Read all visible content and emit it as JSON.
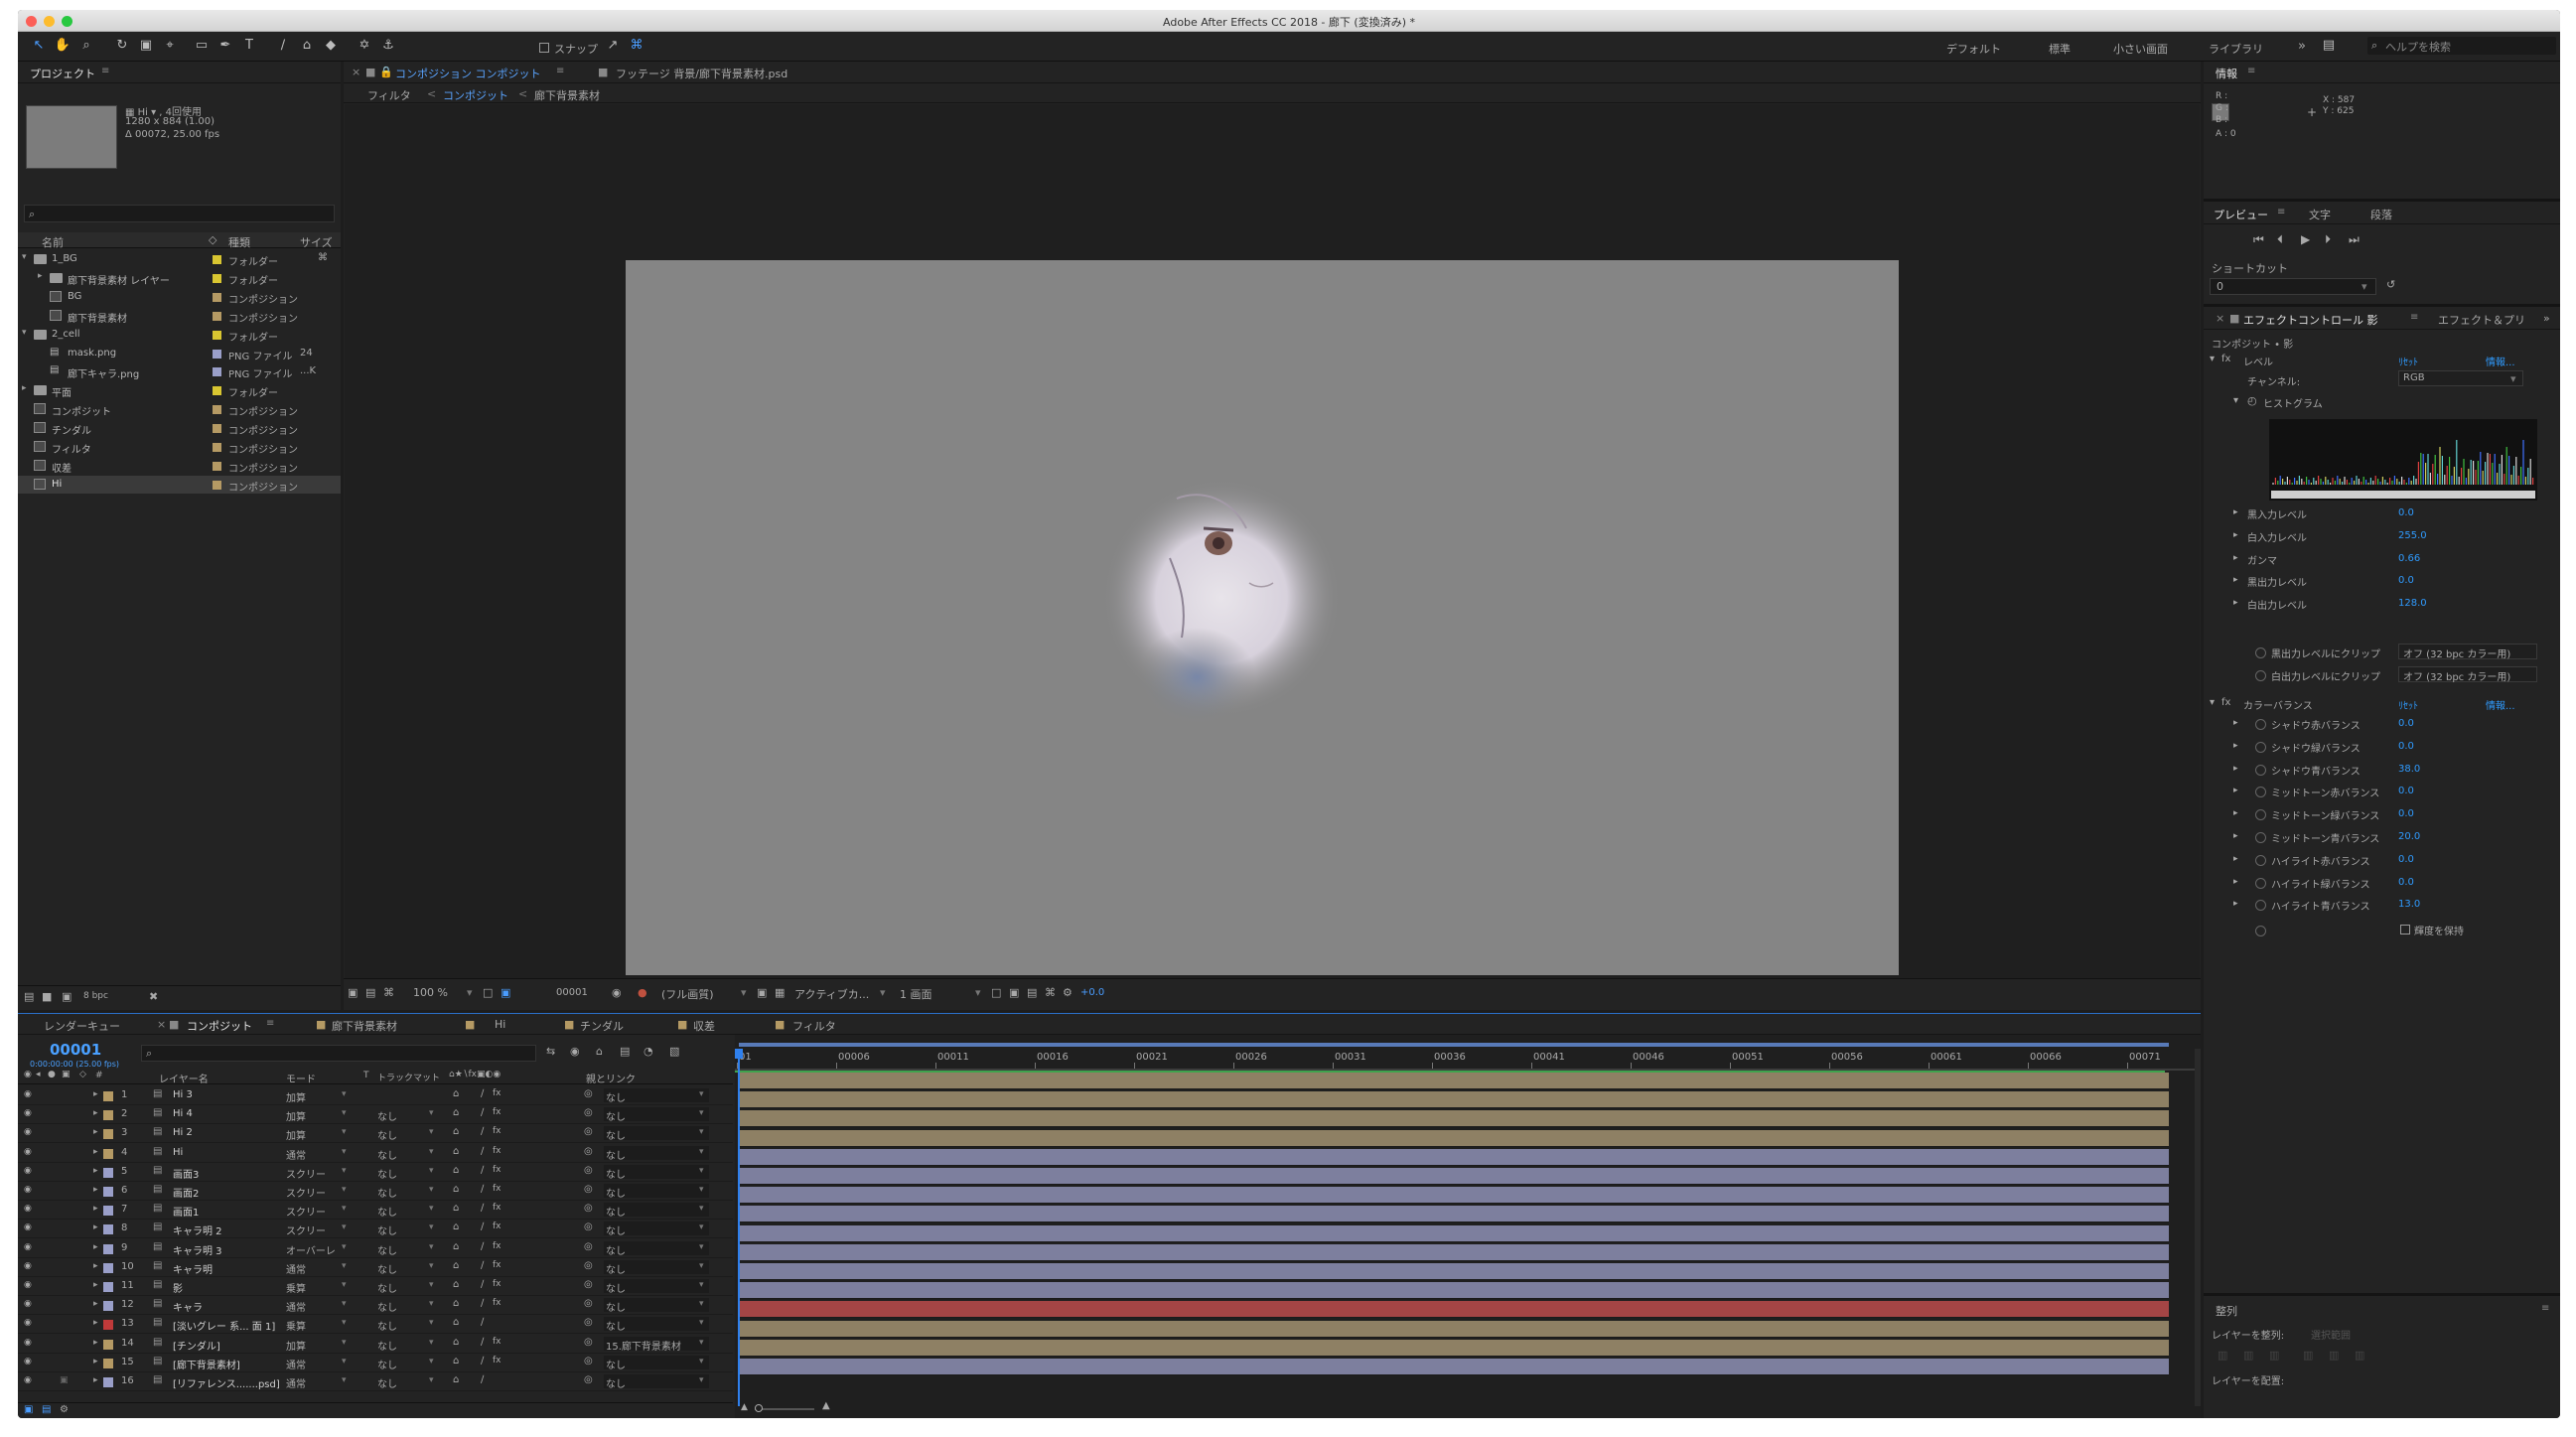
{
  "app": {
    "title": "Adobe After Effects CC 2018 - 廊下 (変換済み) *"
  },
  "toolbar": {
    "snap_label": "スナップ",
    "workspaces": [
      "デフォルト",
      "標準",
      "小さい画面",
      "ライブラリ"
    ],
    "more": "»",
    "search_placeholder": "ヘルプを検索"
  },
  "project": {
    "title": "プロジェクト",
    "thumb_info": [
      "▦ Hi ▾ , 4回使用",
      "1280 x 884 (1.00)",
      "Δ 00072, 25.00 fps"
    ],
    "search_placeholder": "",
    "columns": {
      "name": "名前",
      "type": "種類",
      "size": "サイズ"
    },
    "items": [
      {
        "name": "1_BG",
        "type": "フォルダー",
        "size": "",
        "kind": "folder",
        "indent": 0,
        "open": true,
        "color": "#d9c631"
      },
      {
        "name": "廊下背景素材 レイヤー",
        "type": "フォルダー",
        "size": "",
        "kind": "folder",
        "indent": 1,
        "open": false,
        "color": "#d9c631"
      },
      {
        "name": "BG",
        "type": "コンポジション",
        "size": "",
        "kind": "comp",
        "indent": 1,
        "color": "#b59a64"
      },
      {
        "name": "廊下背景素材",
        "type": "コンポジション",
        "size": "",
        "kind": "comp",
        "indent": 1,
        "color": "#b59a64"
      },
      {
        "name": "2_cell",
        "type": "フォルダー",
        "size": "",
        "kind": "folder",
        "indent": 0,
        "open": true,
        "color": "#d9c631"
      },
      {
        "name": "mask.png",
        "type": "PNG ファイル",
        "size": "24",
        "kind": "file",
        "indent": 1,
        "color": "#9a9fc9"
      },
      {
        "name": "廊下キャラ.png",
        "type": "PNG ファイル",
        "size": "...K",
        "kind": "file",
        "indent": 1,
        "color": "#9a9fc9"
      },
      {
        "name": "平面",
        "type": "フォルダー",
        "size": "",
        "kind": "folder",
        "indent": 0,
        "open": false,
        "color": "#d9c631"
      },
      {
        "name": "コンポジット",
        "type": "コンポジション",
        "size": "",
        "kind": "comp",
        "indent": 0,
        "color": "#b59a64"
      },
      {
        "name": "チンダル",
        "type": "コンポジション",
        "size": "",
        "kind": "comp",
        "indent": 0,
        "color": "#b59a64"
      },
      {
        "name": "フィルタ",
        "type": "コンポジション",
        "size": "",
        "kind": "comp",
        "indent": 0,
        "color": "#b59a64"
      },
      {
        "name": "収差",
        "type": "コンポジション",
        "size": "",
        "kind": "comp",
        "indent": 0,
        "color": "#b59a64"
      },
      {
        "name": "Hi",
        "type": "コンポジション",
        "size": "",
        "kind": "comp",
        "indent": 0,
        "color": "#b59a64",
        "selected": true
      }
    ],
    "bpc": "8 bpc"
  },
  "viewer": {
    "tabs": [
      "コンポジション コンポジット",
      "フッテージ 背景/廊下背景素材.psd"
    ],
    "breadcrumbs": [
      "フィルタ",
      "コンポジット",
      "廊下背景素材"
    ],
    "zoom": "100 %",
    "timecode": "00001",
    "resolution": "(フル画質)",
    "camera": "アクティブカ...",
    "views": "1 画面",
    "exposure": "+0.0"
  },
  "timeline": {
    "tabs": [
      "レンダーキュー",
      "コンポジット",
      "廊下背景素材",
      "Hi",
      "チンダル",
      "収差",
      "フィルタ"
    ],
    "timecode": "00001",
    "timecode_sub": "0:00:00:00 (25.00 fps)",
    "columns": {
      "num": "#",
      "name": "レイヤー名",
      "mode": "モード",
      "t": "T",
      "matte": "トラックマット",
      "parent": "親とリンク"
    },
    "ruler": [
      "01",
      "00006",
      "00011",
      "00016",
      "00021",
      "00026",
      "00031",
      "00036",
      "00041",
      "00046",
      "00051",
      "00056",
      "00061",
      "00066",
      "00071"
    ],
    "layers": [
      {
        "n": "1",
        "name": "Hi 3",
        "mode": "加算",
        "matte": "",
        "parent": "なし",
        "color": "#b59a64",
        "bar": "#8e8064"
      },
      {
        "n": "2",
        "name": "Hi 4",
        "mode": "加算",
        "matte": "なし",
        "parent": "なし",
        "color": "#b59a64",
        "bar": "#8e8064"
      },
      {
        "n": "3",
        "name": "Hi 2",
        "mode": "加算",
        "matte": "なし",
        "parent": "なし",
        "color": "#b59a64",
        "bar": "#8e8064"
      },
      {
        "n": "4",
        "name": "Hi",
        "mode": "通常",
        "matte": "なし",
        "parent": "なし",
        "color": "#b59a64",
        "bar": "#8e8064"
      },
      {
        "n": "5",
        "name": "画面3",
        "mode": "スクリー",
        "matte": "なし",
        "parent": "なし",
        "color": "#9a9fc9",
        "bar": "#7d7f9e"
      },
      {
        "n": "6",
        "name": "画面2",
        "mode": "スクリー",
        "matte": "なし",
        "parent": "なし",
        "color": "#9a9fc9",
        "bar": "#7d7f9e"
      },
      {
        "n": "7",
        "name": "画面1",
        "mode": "スクリー",
        "matte": "なし",
        "parent": "なし",
        "color": "#9a9fc9",
        "bar": "#7d7f9e"
      },
      {
        "n": "8",
        "name": "キャラ明 2",
        "mode": "スクリー",
        "matte": "なし",
        "parent": "なし",
        "color": "#9a9fc9",
        "bar": "#7d7f9e"
      },
      {
        "n": "9",
        "name": "キャラ明 3",
        "mode": "オーバーレ",
        "matte": "なし",
        "parent": "なし",
        "color": "#9a9fc9",
        "bar": "#7d7f9e"
      },
      {
        "n": "10",
        "name": "キャラ明",
        "mode": "通常",
        "matte": "なし",
        "parent": "なし",
        "color": "#9a9fc9",
        "bar": "#7d7f9e"
      },
      {
        "n": "11",
        "name": "影",
        "mode": "乗算",
        "matte": "なし",
        "parent": "なし",
        "color": "#9a9fc9",
        "bar": "#7d7f9e"
      },
      {
        "n": "12",
        "name": "キャラ",
        "mode": "通常",
        "matte": "なし",
        "parent": "なし",
        "color": "#9a9fc9",
        "bar": "#7d7f9e"
      },
      {
        "n": "13",
        "name": "[淡いグレー 系... 面 1]",
        "mode": "乗算",
        "matte": "なし",
        "parent": "なし",
        "color": "#c03a3a",
        "bar": "#a44545"
      },
      {
        "n": "14",
        "name": "[チンダル]",
        "mode": "加算",
        "matte": "なし",
        "parent": "15.廊下背景素材",
        "color": "#b59a64",
        "bar": "#8e8064"
      },
      {
        "n": "15",
        "name": "[廊下背景素材]",
        "mode": "通常",
        "matte": "なし",
        "parent": "なし",
        "color": "#b59a64",
        "bar": "#8e8064"
      },
      {
        "n": "16",
        "name": "[リファレンス.......psd]",
        "mode": "通常",
        "matte": "なし",
        "parent": "なし",
        "color": "#9a9fc9",
        "bar": "#7d7f9e"
      }
    ]
  },
  "info": {
    "title": "情報",
    "r": "R :",
    "g": "G :",
    "b": "B :",
    "a": "A : 0",
    "x": "X : 587",
    "y": "Y : 625"
  },
  "preview": {
    "tabs": [
      "プレビュー",
      "文字",
      "段落"
    ],
    "shortcut_label": "ショートカット",
    "shortcut_value": "0"
  },
  "effects": {
    "tab": "エフェクトコントロール 影",
    "tab2": "エフェクト＆プリ",
    "target": "コンポジット • 影",
    "levels": {
      "name": "レベル",
      "reset": "ﾘｾｯﾄ",
      "about": "情報...",
      "channel_label": "チャンネル:",
      "channel_value": "RGB",
      "histogram_label": "ヒストグラム",
      "params": [
        {
          "label": "黒入力レベル",
          "value": "0.0"
        },
        {
          "label": "白入力レベル",
          "value": "255.0"
        },
        {
          "label": "ガンマ",
          "value": "0.66"
        },
        {
          "label": "黒出力レベル",
          "value": "0.0"
        },
        {
          "label": "白出力レベル",
          "value": "128.0"
        }
      ],
      "clip_black_label": "黒出力レベルにクリップ",
      "clip_black_value": "オフ (32 bpc カラー用)",
      "clip_white_label": "白出力レベルにクリップ",
      "clip_white_value": "オフ (32 bpc カラー用)"
    },
    "color_balance": {
      "name": "カラーバランス",
      "reset": "ﾘｾｯﾄ",
      "about": "情報...",
      "params": [
        {
          "label": "シャドウ赤バランス",
          "value": "0.0"
        },
        {
          "label": "シャドウ緑バランス",
          "value": "0.0"
        },
        {
          "label": "シャドウ青バランス",
          "value": "38.0"
        },
        {
          "label": "ミッドトーン赤バランス",
          "value": "0.0"
        },
        {
          "label": "ミッドトーン緑バランス",
          "value": "0.0"
        },
        {
          "label": "ミッドトーン青バランス",
          "value": "20.0"
        },
        {
          "label": "ハイライト赤バランス",
          "value": "0.0"
        },
        {
          "label": "ハイライト緑バランス",
          "value": "0.0"
        },
        {
          "label": "ハイライト青バランス",
          "value": "13.0"
        }
      ],
      "preserve_label": "輝度を保持"
    }
  },
  "align": {
    "title": "整列",
    "align_to_label": "レイヤーを整列:",
    "align_to_value": "選択範囲",
    "distribute_label": "レイヤーを配置:"
  }
}
